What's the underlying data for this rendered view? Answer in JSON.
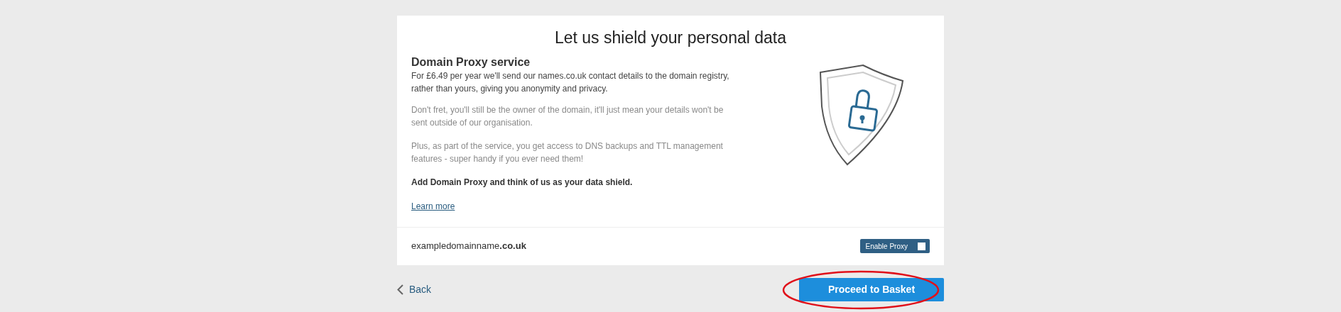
{
  "title": "Let us shield your personal data",
  "service": {
    "heading": "Domain Proxy service",
    "paragraphs": [
      {
        "kind": "lead",
        "text": "For £6.49 per year we'll send our names.co.uk contact details to the domain registry, rather than yours, giving you anonymity and privacy."
      },
      {
        "kind": "muted",
        "text": "Don't fret, you'll still be the owner of the domain, it'll just mean your details won't be sent outside of our organisation."
      },
      {
        "kind": "muted",
        "text": "Plus, as part of the service, you get access to DNS backups and TTL management features - super handy if you ever need them!"
      },
      {
        "kind": "strong",
        "text": "Add Domain Proxy and think of us as your data shield."
      }
    ],
    "link": "Learn more"
  },
  "domain": {
    "name": "exampledomainname**.co.uk**",
    "toggle_label": "Enable Proxy",
    "checked": false
  },
  "back": "Back",
  "proceed": {
    "label": "Proceed to Basket",
    "highlighted": true
  }
}
